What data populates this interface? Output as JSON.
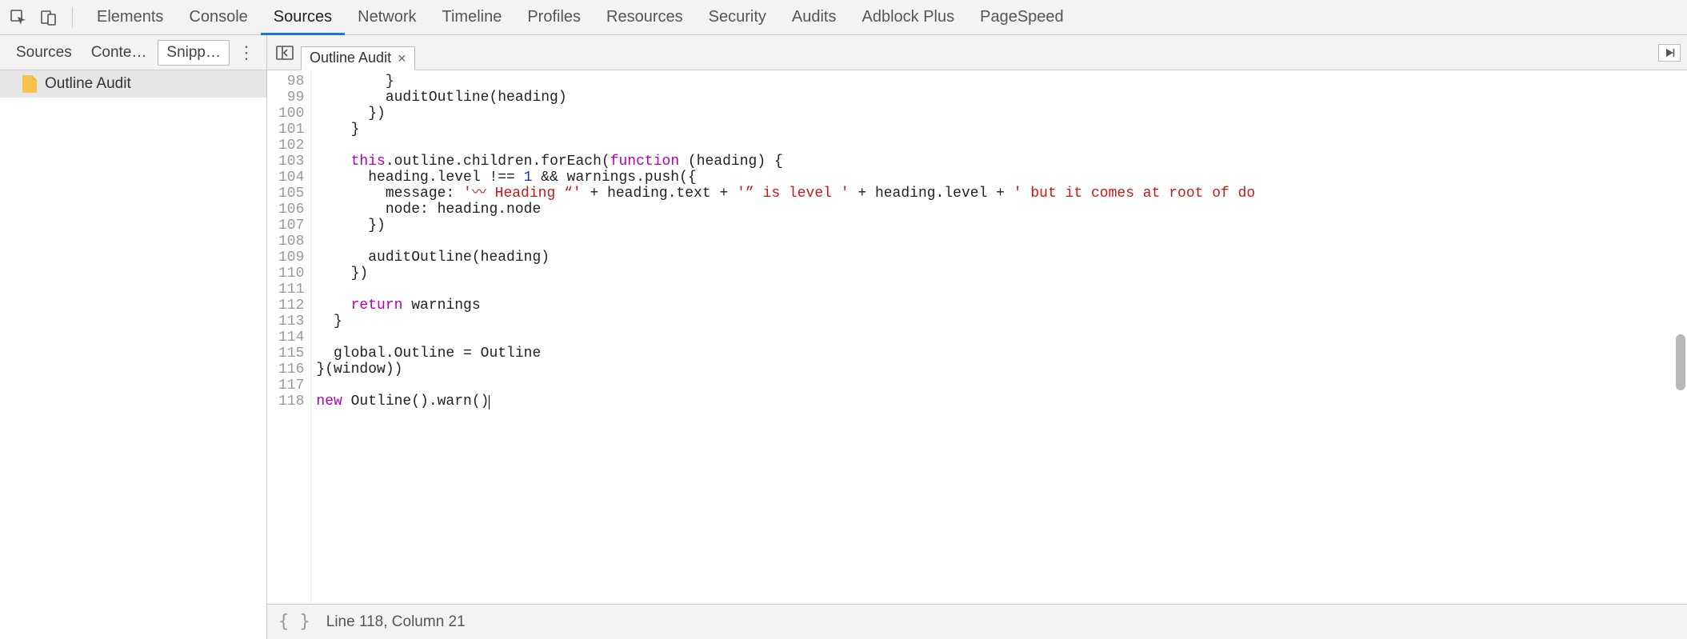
{
  "toolbar": {
    "tabs": [
      "Elements",
      "Console",
      "Sources",
      "Network",
      "Timeline",
      "Profiles",
      "Resources",
      "Security",
      "Audits",
      "Adblock Plus",
      "PageSpeed"
    ],
    "active_index": 2
  },
  "sidebar": {
    "tabs": [
      "Sources",
      "Conte…",
      "Snipp…"
    ],
    "active_index": 2,
    "items": [
      {
        "label": "Outline Audit"
      }
    ]
  },
  "file_tabs": {
    "items": [
      {
        "label": "Outline Audit"
      }
    ],
    "active_index": 0
  },
  "editor": {
    "first_line": 98,
    "lines": [
      {
        "n": 98,
        "segments": [
          {
            "t": "        }"
          }
        ]
      },
      {
        "n": 99,
        "segments": [
          {
            "t": "        auditOutline(heading)"
          }
        ]
      },
      {
        "n": 100,
        "segments": [
          {
            "t": "      })"
          }
        ]
      },
      {
        "n": 101,
        "segments": [
          {
            "t": "    }"
          }
        ]
      },
      {
        "n": 102,
        "segments": [
          {
            "t": ""
          }
        ]
      },
      {
        "n": 103,
        "segments": [
          {
            "t": "    "
          },
          {
            "cls": "kw",
            "t": "this"
          },
          {
            "t": ".outline.children.forEach("
          },
          {
            "cls": "kw",
            "t": "function"
          },
          {
            "t": " (heading) {"
          }
        ]
      },
      {
        "n": 104,
        "segments": [
          {
            "t": "      heading.level !== "
          },
          {
            "cls": "num",
            "t": "1"
          },
          {
            "t": " && warnings.push({"
          }
        ]
      },
      {
        "n": 105,
        "segments": [
          {
            "t": "        message: "
          },
          {
            "cls": "str",
            "t": "'〰 Heading “'"
          },
          {
            "t": " + heading.text + "
          },
          {
            "cls": "str",
            "t": "'” is level '"
          },
          {
            "t": " + heading.level + "
          },
          {
            "cls": "str",
            "t": "' but it comes at root of do"
          }
        ]
      },
      {
        "n": 106,
        "segments": [
          {
            "t": "        node: heading.node"
          }
        ]
      },
      {
        "n": 107,
        "segments": [
          {
            "t": "      })"
          }
        ]
      },
      {
        "n": 108,
        "segments": [
          {
            "t": ""
          }
        ]
      },
      {
        "n": 109,
        "segments": [
          {
            "t": "      auditOutline(heading)"
          }
        ]
      },
      {
        "n": 110,
        "segments": [
          {
            "t": "    })"
          }
        ]
      },
      {
        "n": 111,
        "segments": [
          {
            "t": ""
          }
        ]
      },
      {
        "n": 112,
        "segments": [
          {
            "t": "    "
          },
          {
            "cls": "kw",
            "t": "return"
          },
          {
            "t": " warnings"
          }
        ]
      },
      {
        "n": 113,
        "segments": [
          {
            "t": "  }"
          }
        ]
      },
      {
        "n": 114,
        "segments": [
          {
            "t": ""
          }
        ]
      },
      {
        "n": 115,
        "segments": [
          {
            "t": "  global.Outline = Outline"
          }
        ]
      },
      {
        "n": 116,
        "segments": [
          {
            "t": "}(window))"
          }
        ]
      },
      {
        "n": 117,
        "segments": [
          {
            "t": ""
          }
        ]
      },
      {
        "n": 118,
        "segments": [
          {
            "cls": "kw",
            "t": "new"
          },
          {
            "t": " Outline().warn()"
          }
        ],
        "cursor_after": true
      }
    ]
  },
  "status": {
    "braces": "{ }",
    "position": "Line 118, Column 21"
  }
}
